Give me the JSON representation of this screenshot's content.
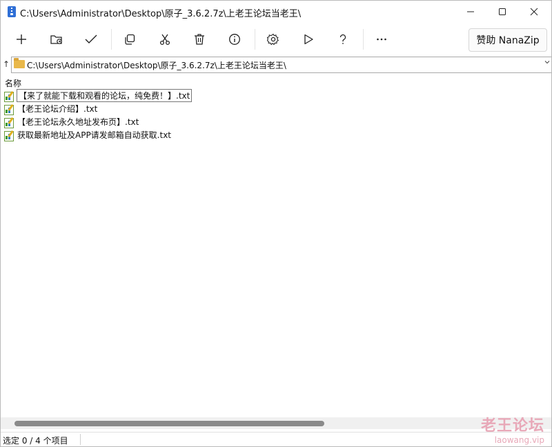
{
  "window": {
    "title": "C:\\Users\\Administrator\\Desktop\\原子_3.6.2.7z\\上老王论坛当老王\\",
    "icon": "nanazip-archive-icon"
  },
  "toolbar": {
    "buttons": [
      {
        "icon": "add-icon"
      },
      {
        "icon": "extract-folder-icon"
      },
      {
        "icon": "test-check-icon"
      },
      {
        "icon": "copy-icon"
      },
      {
        "icon": "cut-move-icon"
      },
      {
        "icon": "delete-icon"
      },
      {
        "icon": "info-icon"
      },
      {
        "icon": "settings-gear-icon"
      },
      {
        "icon": "benchmark-play-icon"
      },
      {
        "icon": "help-icon"
      },
      {
        "icon": "more-icon"
      }
    ],
    "sponsor_label": "赞助 NanaZip"
  },
  "address": {
    "up_glyph": "↑",
    "path": "C:\\Users\\Administrator\\Desktop\\原子_3.6.2.7z\\上老王论坛当老王\\"
  },
  "list": {
    "column_header": "名称",
    "files": [
      {
        "name": "【来了就能下载和观看的论坛，纯免费！】.txt",
        "focused": true
      },
      {
        "name": "【老王论坛介绍】.txt",
        "focused": false
      },
      {
        "name": "【老王论坛永久地址发布页】.txt",
        "focused": false
      },
      {
        "name": "获取最新地址及APP请发邮箱自动获取.txt",
        "focused": false
      }
    ]
  },
  "status": {
    "text": "选定 0 / 4 个项目"
  },
  "watermark": {
    "cn": "老王论坛",
    "en": "laowang.vip"
  },
  "colors": {
    "accent": "#2f6fd6",
    "folder": "#e9b84a",
    "watermark": "#e8a8b8"
  }
}
